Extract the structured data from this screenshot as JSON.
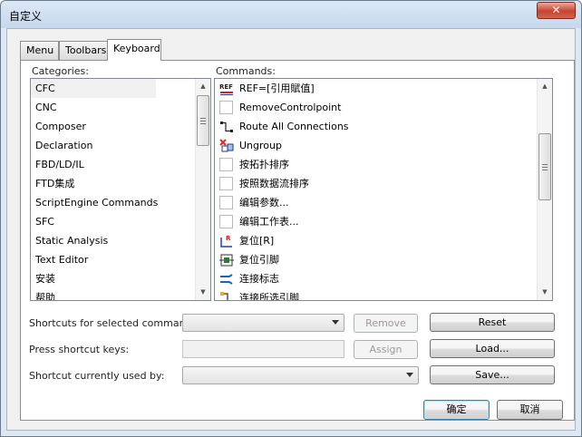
{
  "window": {
    "title": "自定义",
    "close_icon": "close-icon"
  },
  "tabs": [
    "Menu",
    "Toolbars",
    "Keyboard"
  ],
  "active_tab": "Keyboard",
  "categories": {
    "label": "Categories:",
    "items": [
      "CFC",
      "CNC",
      "Composer",
      "Declaration",
      "FBD/LD/IL",
      "FTD集成",
      "ScriptEngine Commands",
      "SFC",
      "Static Analysis",
      "Text Editor",
      "安装",
      "帮助"
    ],
    "selected": "CFC"
  },
  "commands": {
    "label": "Commands:",
    "items": [
      {
        "text": "REF=[引用賦值]",
        "icon": "ref-assign-icon"
      },
      {
        "text": "RemoveControlpoint",
        "icon": "blank-icon"
      },
      {
        "text": "Route All Connections",
        "icon": "route-connections-icon"
      },
      {
        "text": "Ungroup",
        "icon": "ungroup-icon"
      },
      {
        "text": "按拓扑排序",
        "icon": "blank-icon"
      },
      {
        "text": "按照数据流排序",
        "icon": "blank-icon"
      },
      {
        "text": "编辑参数...",
        "icon": "blank-icon"
      },
      {
        "text": "编辑工作表...",
        "icon": "blank-icon"
      },
      {
        "text": "复位[R]",
        "icon": "reset-r-icon"
      },
      {
        "text": "复位引脚",
        "icon": "reset-pin-icon"
      },
      {
        "text": "连接标志",
        "icon": "connection-mark-icon"
      },
      {
        "text": "连接所选引脚",
        "icon": "connect-selected-pins-icon"
      }
    ]
  },
  "shortcuts": {
    "selected_label": "Shortcuts for selected command:",
    "press_label": "Press shortcut keys:",
    "used_by_label": "Shortcut currently used by:",
    "selected_value": "",
    "press_value": "",
    "used_by_value": ""
  },
  "buttons": {
    "remove": "Remove",
    "assign": "Assign",
    "reset": "Reset",
    "load": "Load...",
    "save": "Save...",
    "ok": "确定",
    "cancel": "取消"
  }
}
